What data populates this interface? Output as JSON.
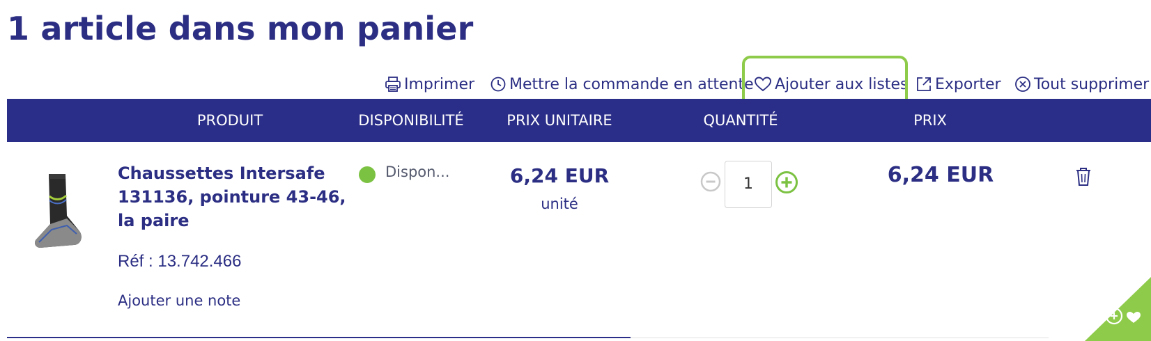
{
  "page": {
    "title": "1 article dans mon panier"
  },
  "toolbar": {
    "print": "Imprimer",
    "hold": "Mettre la commande en attente",
    "add_to_lists": "Ajouter aux listes",
    "export": "Exporter",
    "delete_all": "Tout supprimer"
  },
  "table": {
    "headers": [
      "PRODUIT",
      "DISPONIBILITÉ",
      "PRIX UNITAIRE",
      "QUANTITÉ",
      "PRIX"
    ]
  },
  "item": {
    "name": "Chaussettes Intersafe 131136, pointure 43-46, la paire",
    "ref": "Réf : 13.742.466",
    "note_link": "Ajouter une note",
    "availability": "Dispon...",
    "availability_color": "#7cc242",
    "unit_price": "6,24 EUR",
    "unit_label": "unité",
    "quantity": "1",
    "price": "6,24 EUR"
  },
  "colors": {
    "brand": "#2b2e83",
    "header_bg": "#2b2e88",
    "accent_green": "#8ecb4a"
  },
  "icons": [
    "printer-icon",
    "clock-icon",
    "heart-icon",
    "export-icon",
    "close-circle-icon",
    "minus-circle-icon",
    "plus-circle-icon",
    "trash-icon",
    "add-to-wishlist-icon"
  ]
}
